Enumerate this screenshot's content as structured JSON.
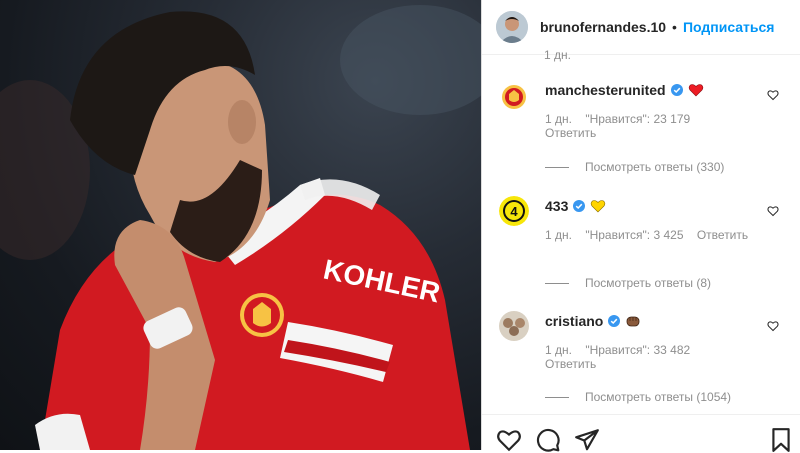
{
  "post": {
    "photo_alt": "KOHLER"
  },
  "header": {
    "username": "brunofernandes.10",
    "separator": "•",
    "follow_label": "Подписаться"
  },
  "cut_text": "1 дн.",
  "comments": [
    {
      "username": "manchesterunited",
      "emoji": "red-heart",
      "time": "1 дн.",
      "likes": "\"Нравится\": 23 179",
      "reply": "Ответить",
      "view_replies": "Посмотреть ответы (330)"
    },
    {
      "username": "433",
      "emoji": "yellow-heart",
      "time": "1 дн.",
      "likes": "\"Нравится\": 3 425",
      "reply": "Ответить",
      "view_replies": "Посмотреть ответы (8)"
    },
    {
      "username": "cristiano",
      "emoji": "fist-bump",
      "time": "1 дн.",
      "likes": "\"Нравится\": 33 482",
      "reply": "Ответить",
      "view_replies": "Посмотреть ответы (1054)"
    }
  ],
  "colors": {
    "accent": "#0095f6",
    "verified": "#3897f0",
    "heart_red": "#ed1c24",
    "heart_yellow": "#ffd400",
    "shirt_red": "#d11a21"
  }
}
